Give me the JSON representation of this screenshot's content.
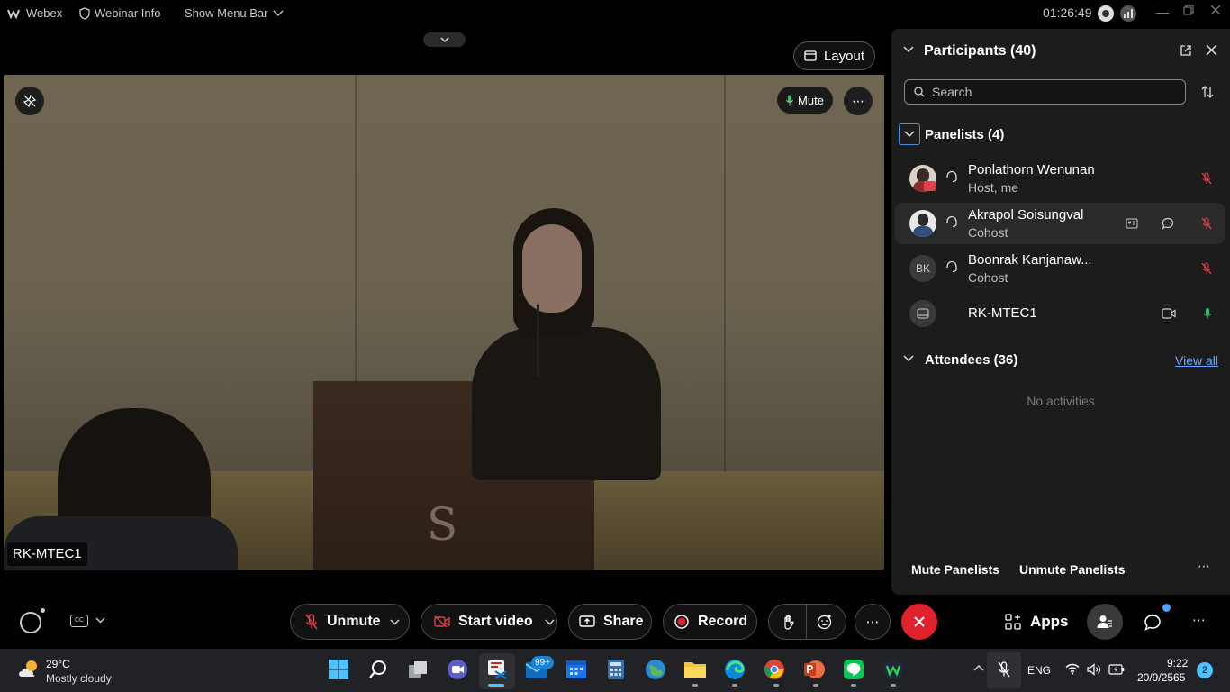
{
  "topbar": {
    "app_name": "Webex",
    "webinar_info": "Webinar Info",
    "show_menu_bar": "Show Menu Bar",
    "timer": "01:26:49"
  },
  "video": {
    "layout_label": "Layout",
    "mute_label": "Mute",
    "name_tag": "RK-MTEC1"
  },
  "participants": {
    "title": "Participants (40)",
    "search_placeholder": "Search",
    "panelists_title": "Panelists (4)",
    "panelists": [
      {
        "name": "Ponlathorn Wenunan",
        "role": "Host, me"
      },
      {
        "name": "Akrapol Soisungval",
        "role": "Cohost"
      },
      {
        "name": "Boonrak Kanjanaw...",
        "role": "Cohost",
        "initials": "BK"
      },
      {
        "name": "RK-MTEC1",
        "role": ""
      }
    ],
    "attendees_title": "Attendees (36)",
    "view_all": "View all",
    "no_activities": "No activities",
    "mute_panelists": "Mute Panelists",
    "unmute_panelists": "Unmute Panelists"
  },
  "controls": {
    "unmute": "Unmute",
    "start_video": "Start video",
    "share": "Share",
    "record": "Record",
    "apps": "Apps"
  },
  "taskbar": {
    "temperature": "29°C",
    "weather": "Mostly cloudy",
    "mail_badge": "99+",
    "language": "ENG",
    "time": "9:22",
    "date": "20/9/2565",
    "notification_count": "2"
  },
  "colors": {
    "accent_red": "#e0212e",
    "link_blue": "#6aa8ff",
    "mic_green": "#2fbf71",
    "muted_red": "#e0414b"
  }
}
